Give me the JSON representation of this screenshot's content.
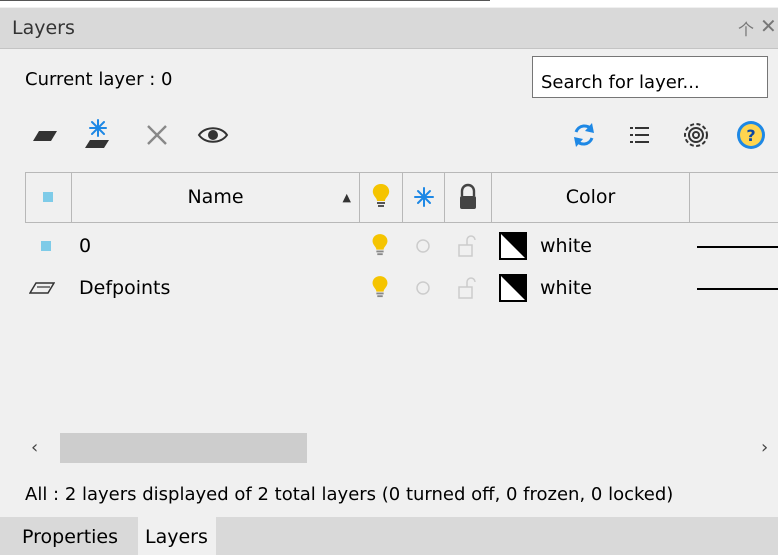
{
  "window": {
    "title": "Layers",
    "pin_glyph": "个",
    "close_glyph": "✕"
  },
  "current_layer": {
    "text": "Current layer : 0"
  },
  "search": {
    "placeholder": "Search for layer..."
  },
  "toolbar": {
    "left": [
      "new-layer-icon",
      "new-vp-frozen-layer-icon",
      "delete-layer-icon",
      "isolate-eye-icon"
    ],
    "right": [
      "refresh-icon",
      "list-icon",
      "settings-gear-icon",
      "help-icon"
    ],
    "help_text": "?"
  },
  "table": {
    "columns": {
      "status": "",
      "name": "Name",
      "sort": "▲",
      "on": "lightbulb-icon",
      "freeze": "snowflake-icon",
      "lock": "lock-icon",
      "color": "Color"
    },
    "rows": [
      {
        "status_icon": "current-layer-square-icon",
        "name": "0",
        "on": true,
        "frozen": false,
        "locked": false,
        "color_swatch": "white-black-swatch",
        "color": "white"
      },
      {
        "status_icon": "layer-parallelogram-icon",
        "name": "Defpoints",
        "on": true,
        "frozen": false,
        "locked": false,
        "color_swatch": "white-black-swatch",
        "color": "white"
      }
    ]
  },
  "scrollbar": {
    "left_arrow": "‹",
    "right_arrow": "›"
  },
  "status": {
    "text": "All : 2 layers displayed of 2 total layers (0 turned off, 0 frozen, 0 locked)"
  },
  "tabs": [
    {
      "label": "Properties",
      "active": false
    },
    {
      "label": "Layers",
      "active": true
    }
  ],
  "colors": {
    "accent_blue": "#1e88e5",
    "bulb_yellow": "#f5c400",
    "current_square": "#7ecbe8"
  }
}
